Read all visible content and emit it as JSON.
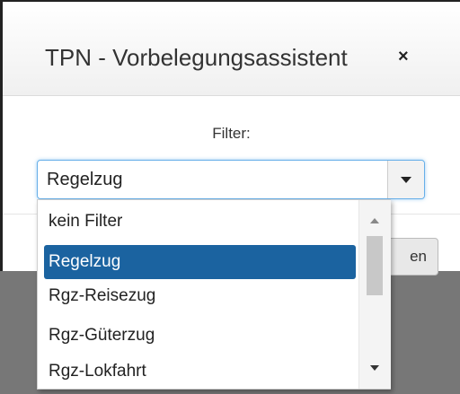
{
  "dialog": {
    "title": "TPN - Vorbelegungsassistent",
    "close_glyph": "×",
    "filter_label": "Filter:",
    "footer_button_partial": "en"
  },
  "combo": {
    "value": "Regelzug",
    "selected_index": 1
  },
  "dropdown": {
    "options": [
      "kein Filter",
      "Regelzug",
      "Rgz-Reisezug",
      "Rgz-Güterzug",
      "Rgz-Lokfahrt"
    ]
  },
  "colors": {
    "selected_bg": "#1b63a0",
    "overlay": "#777777"
  },
  "icons": {
    "close": "close-icon",
    "toggle": "chevron-down-icon",
    "scroll_up": "scroll-up-icon",
    "scroll_down": "scroll-down-icon"
  }
}
